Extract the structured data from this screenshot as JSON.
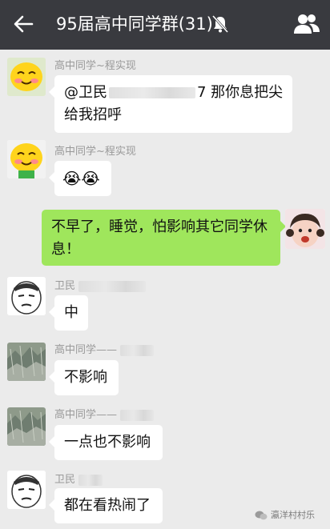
{
  "header": {
    "title": "95届高中同学群(31)",
    "back_icon": "back-arrow-icon",
    "mute_icon": "bell-mute-icon",
    "members_icon": "group-members-icon",
    "bg": "#393a3f"
  },
  "messages": [
    {
      "sender": "高中同学~程实现",
      "text_pre": "@卫民",
      "text_post": "7  那你息把尖",
      "text_line2": "给我招呼"
    },
    {
      "sender": "高中同学~程实现",
      "emoji": "😭😭"
    },
    {
      "sender": "",
      "text": "不早了，睡觉，怕影响其它同学休息！",
      "self": true
    },
    {
      "sender": "卫民",
      "text": "中"
    },
    {
      "sender": "高中同学——",
      "text": "不影响"
    },
    {
      "sender": "高中同学——",
      "text": "一点也不影响"
    },
    {
      "sender": "卫民",
      "text": "都在看热闹了"
    }
  ],
  "watermark": "瀛洋村村乐",
  "colors": {
    "chat_bg": "#ebebeb",
    "self_bubble": "#9fe65c",
    "other_bubble": "#ffffff"
  }
}
